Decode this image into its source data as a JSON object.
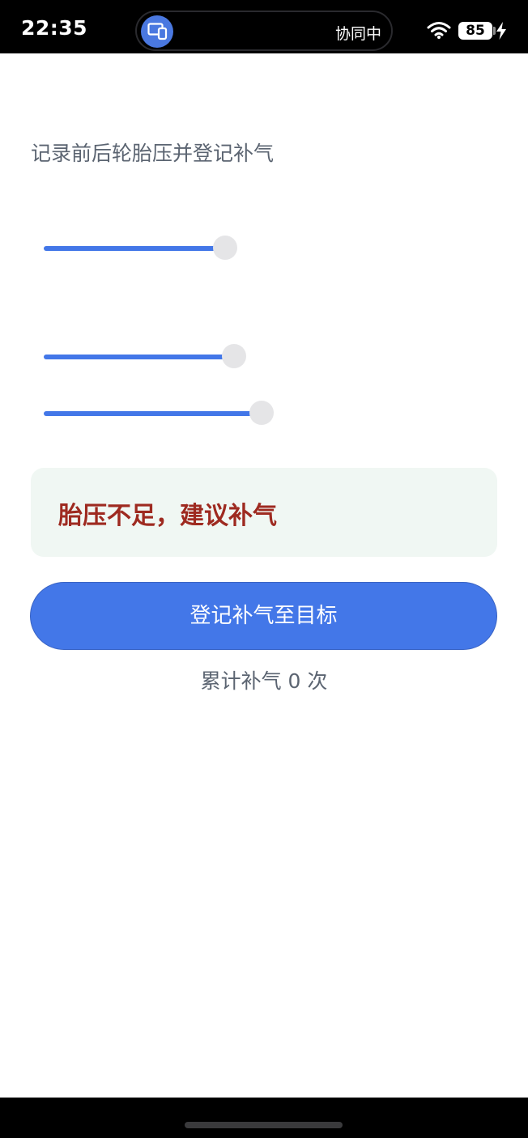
{
  "status_bar": {
    "time": "22:35",
    "collab_label": "协同中",
    "battery_level": "85",
    "charging": true,
    "icons": [
      "screen-share-icon",
      "wifi-icon",
      "battery-icon",
      "charging-icon"
    ]
  },
  "page": {
    "subtitle": "记录前后轮胎压并登记补气"
  },
  "sliders": {
    "front": {
      "fill_fraction": 0.4
    },
    "rear": {
      "fill_fraction": 0.42
    },
    "target": {
      "fill_fraction": 0.48
    }
  },
  "alert": {
    "message": "胎压不足，建议补气",
    "color": "#9e2a20",
    "background": "#f0f7f3"
  },
  "actions": {
    "register_label": "登记补气至目标"
  },
  "counter": {
    "text": "累计补气 0 次"
  },
  "colors": {
    "accent": "#4377e8",
    "muted_text": "#5b6471"
  }
}
